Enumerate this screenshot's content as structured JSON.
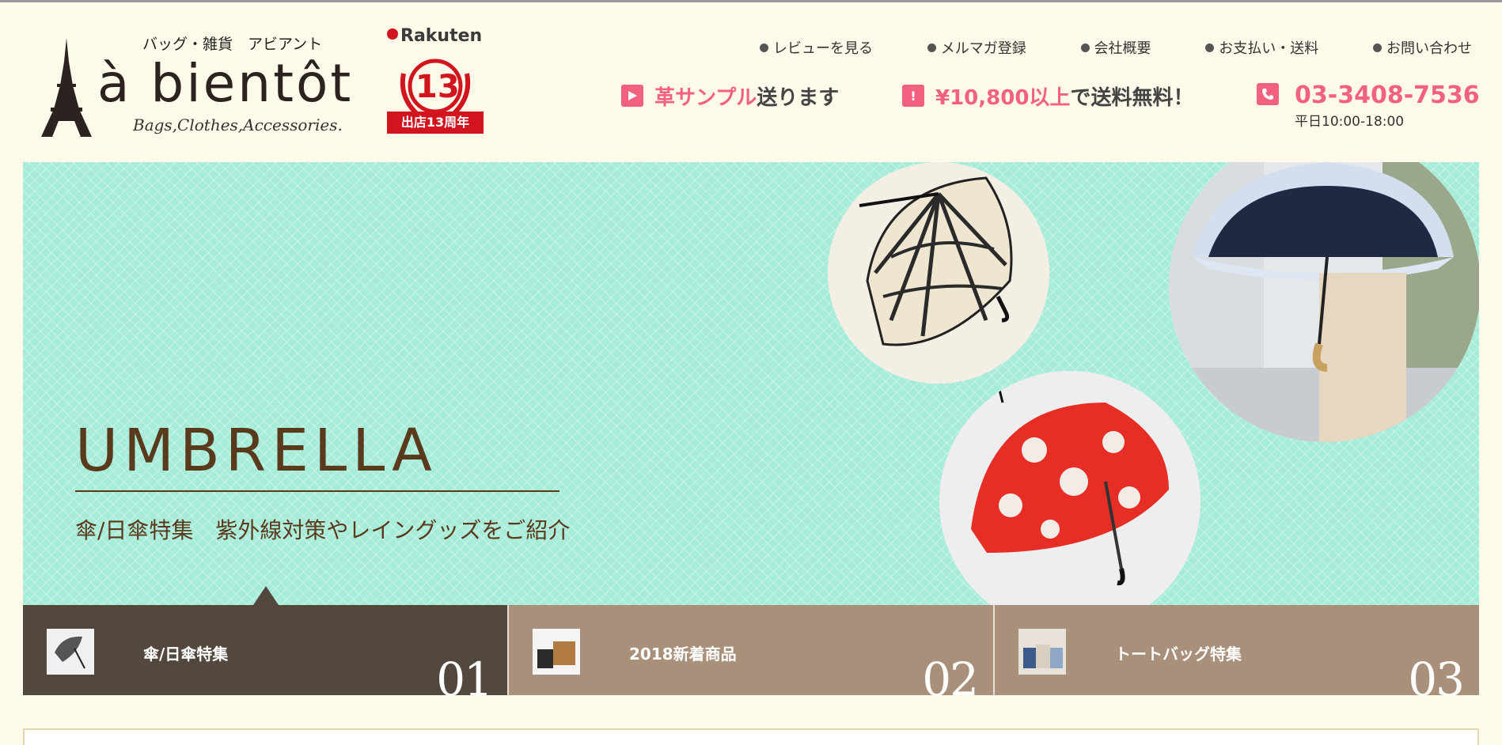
{
  "header": {
    "logo": {
      "subtitle": "バッグ・雑貨　アビアント",
      "name": "à bientôt",
      "tagline": "Bags,Clothes,Accessories."
    },
    "rakuten": {
      "brand": "Rakuten",
      "number": "13",
      "ribbon": "出店13周年"
    },
    "nav": [
      "レビューを見る",
      "メルマガ登録",
      "会社概要",
      "お支払い・送料",
      "お問い合わせ"
    ],
    "promos": {
      "sample": {
        "pink": "革サンプル",
        "dark": "送ります"
      },
      "shipping": {
        "pink": "¥10,800以上",
        "dark": "で送料無料！"
      }
    },
    "phone": {
      "number": "03-3408-7536",
      "hours": "平日10:00-18:00"
    }
  },
  "banner": {
    "title": "UMBRELLA",
    "subtitle": "傘/日傘特集　紫外線対策やレイングッズをご紹介"
  },
  "tabs": [
    {
      "label": "傘/日傘特集",
      "num": "01"
    },
    {
      "label": "2018新着商品",
      "num": "02"
    },
    {
      "label": "トートバッグ特集",
      "num": "03"
    }
  ],
  "colors": {
    "background": "#fefaea",
    "accent_pink": "#f2617d",
    "banner_mint": "#a7ecd9",
    "tab_active": "#52483d",
    "tab_inactive": "#a8907a",
    "rakuten_red": "#d1141e"
  },
  "icons": [
    "eiffel-tower-logo-icon",
    "play-icon",
    "exclamation-icon",
    "phone-icon"
  ]
}
